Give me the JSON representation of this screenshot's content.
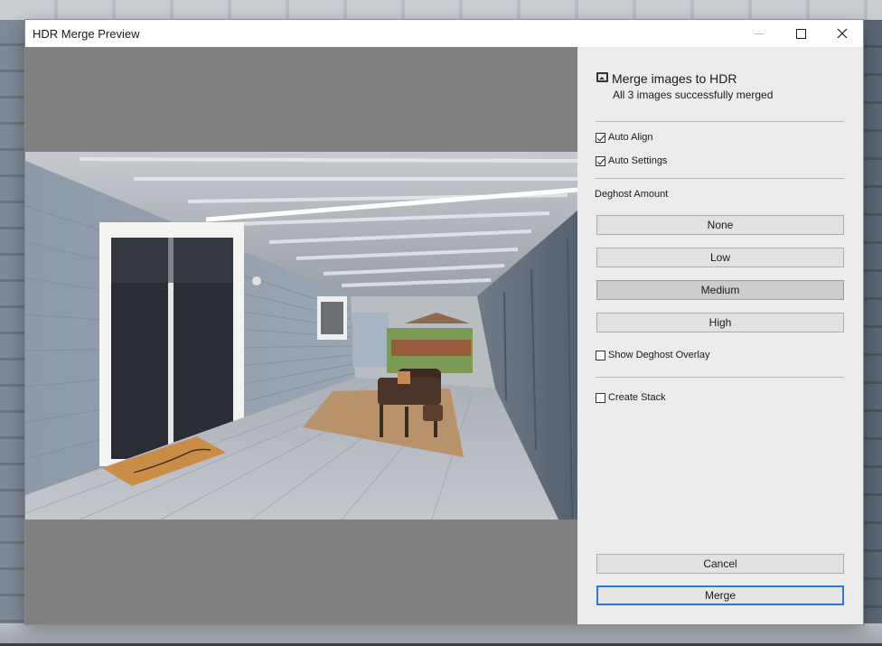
{
  "window": {
    "title": "HDR Merge Preview"
  },
  "panel": {
    "heading": "Merge images to HDR",
    "status": "All 3 images successfully merged",
    "auto_align": {
      "label": "Auto Align",
      "checked": true
    },
    "auto_settings": {
      "label": "Auto Settings",
      "checked": true
    },
    "deghost_label": "Deghost Amount",
    "deghost_options": [
      "None",
      "Low",
      "Medium",
      "High"
    ],
    "deghost_selected": "Medium",
    "show_overlay": {
      "label": "Show Deghost Overlay",
      "checked": false
    },
    "create_stack": {
      "label": "Create Stack",
      "checked": false
    },
    "cancel_label": "Cancel",
    "merge_label": "Merge"
  }
}
